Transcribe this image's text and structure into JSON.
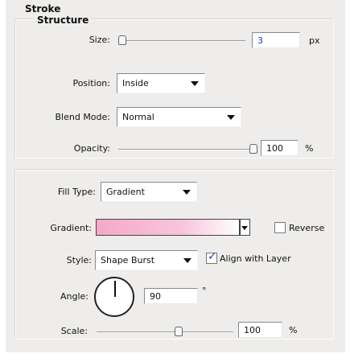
{
  "stroke": {
    "title": "Stroke",
    "structure": {
      "title": "Structure",
      "size": {
        "label": "Size:",
        "value": "3",
        "unit": "px",
        "slider_fraction": 0.0
      },
      "position": {
        "label": "Position:",
        "selected": "Inside"
      },
      "blend_mode": {
        "label": "Blend Mode:",
        "selected": "Normal"
      },
      "opacity": {
        "label": "Opacity:",
        "value": "100",
        "unit": "%",
        "slider_fraction": 1.0
      }
    },
    "fill": {
      "fill_type": {
        "label": "Fill Type:",
        "selected": "Gradient"
      },
      "gradient": {
        "label": "Gradient:",
        "colors": [
          "#f6a8c9",
          "#f9c4dc",
          "#ffffff"
        ],
        "reverse": {
          "label": "Reverse",
          "checked": false
        }
      },
      "style": {
        "label": "Style:",
        "selected": "Shape Burst",
        "align_with_layer": {
          "label": "Align with Layer",
          "checked": true
        }
      },
      "angle": {
        "label": "Angle:",
        "value": "90",
        "unit": "°"
      },
      "scale": {
        "label": "Scale:",
        "value": "100",
        "unit": "%",
        "slider_fraction": 0.68
      }
    }
  }
}
